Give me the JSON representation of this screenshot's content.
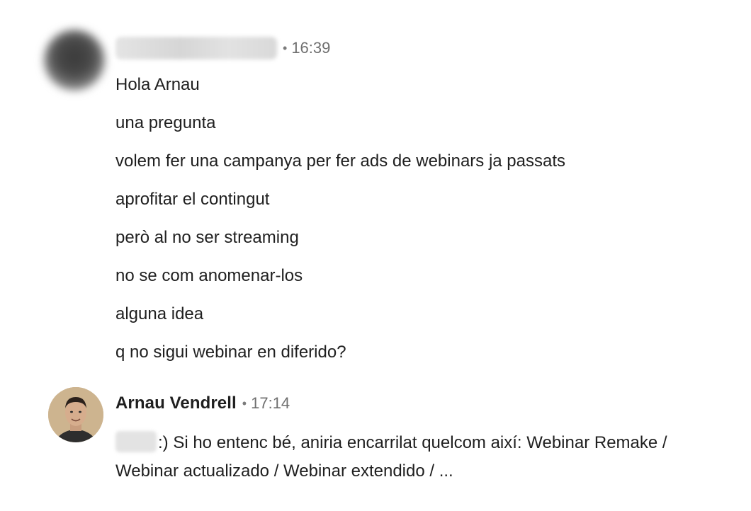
{
  "thread": {
    "messages": [
      {
        "sender_name": "",
        "separator": "•",
        "time": "16:39",
        "lines": [
          "Hola Arnau",
          "una pregunta",
          "volem fer una campanya per fer ads de webinars ja passats",
          "aprofitar el contingut",
          "però al no ser streaming",
          "no se com anomenar-los",
          "alguna idea",
          "q no sigui webinar en diferido?"
        ]
      },
      {
        "sender_name": "Arnau Vendrell",
        "separator": "•",
        "time": "17:14",
        "text": ":) Si ho entenc bé, aniria encarrilat quelcom així: Webinar Remake / Webinar actualizado / Webinar extendido / ..."
      }
    ]
  },
  "icons": {
    "avatar_1": "blurred-avatar",
    "avatar_2": "profile-photo"
  },
  "colors": {
    "text": "#202020",
    "muted": "#6f6f6f",
    "background": "#ffffff"
  }
}
